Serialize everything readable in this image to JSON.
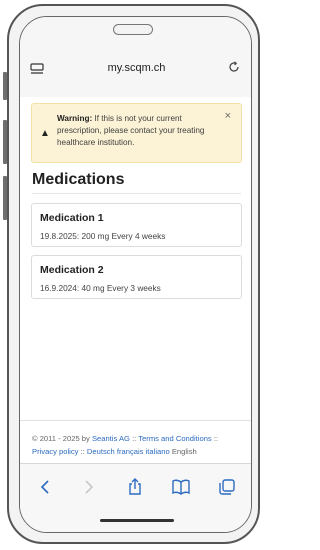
{
  "browser": {
    "url": "my.scqm.ch"
  },
  "alert": {
    "strong": "Warning:",
    "body": "If this is not your current prescription, please contact your treating healthcare institution.",
    "close": "×"
  },
  "page": {
    "title": "Medications"
  },
  "medications": [
    {
      "name": "Medication 1",
      "detail": "19.8.2025: 200 mg Every 4 weeks"
    },
    {
      "name": "Medication 2",
      "detail": "16.9.2024: 40 mg Every 3 weeks"
    }
  ],
  "footer": {
    "copyright": "© 2011 - 2025 by",
    "company": "Seantis AG",
    "sep1": "::",
    "terms": "Terms and Conditions",
    "sep2": "::",
    "privacy": "Privacy policy",
    "sep3": "::",
    "lang_de": "Deutsch",
    "lang_fr": "français",
    "lang_it": "italiano",
    "lang_en": "English"
  },
  "colors": {
    "accent": "#2d6bc0",
    "alert_bg": "#fcf3d6",
    "text": "#222222"
  },
  "icons": {
    "tab_view": "reader-icon",
    "reload": "reload-icon",
    "warning": "warning-icon",
    "back": "back-icon",
    "forward": "forward-icon",
    "share": "share-icon",
    "bookmarks": "bookmarks-icon",
    "tabs": "tabs-icon"
  }
}
